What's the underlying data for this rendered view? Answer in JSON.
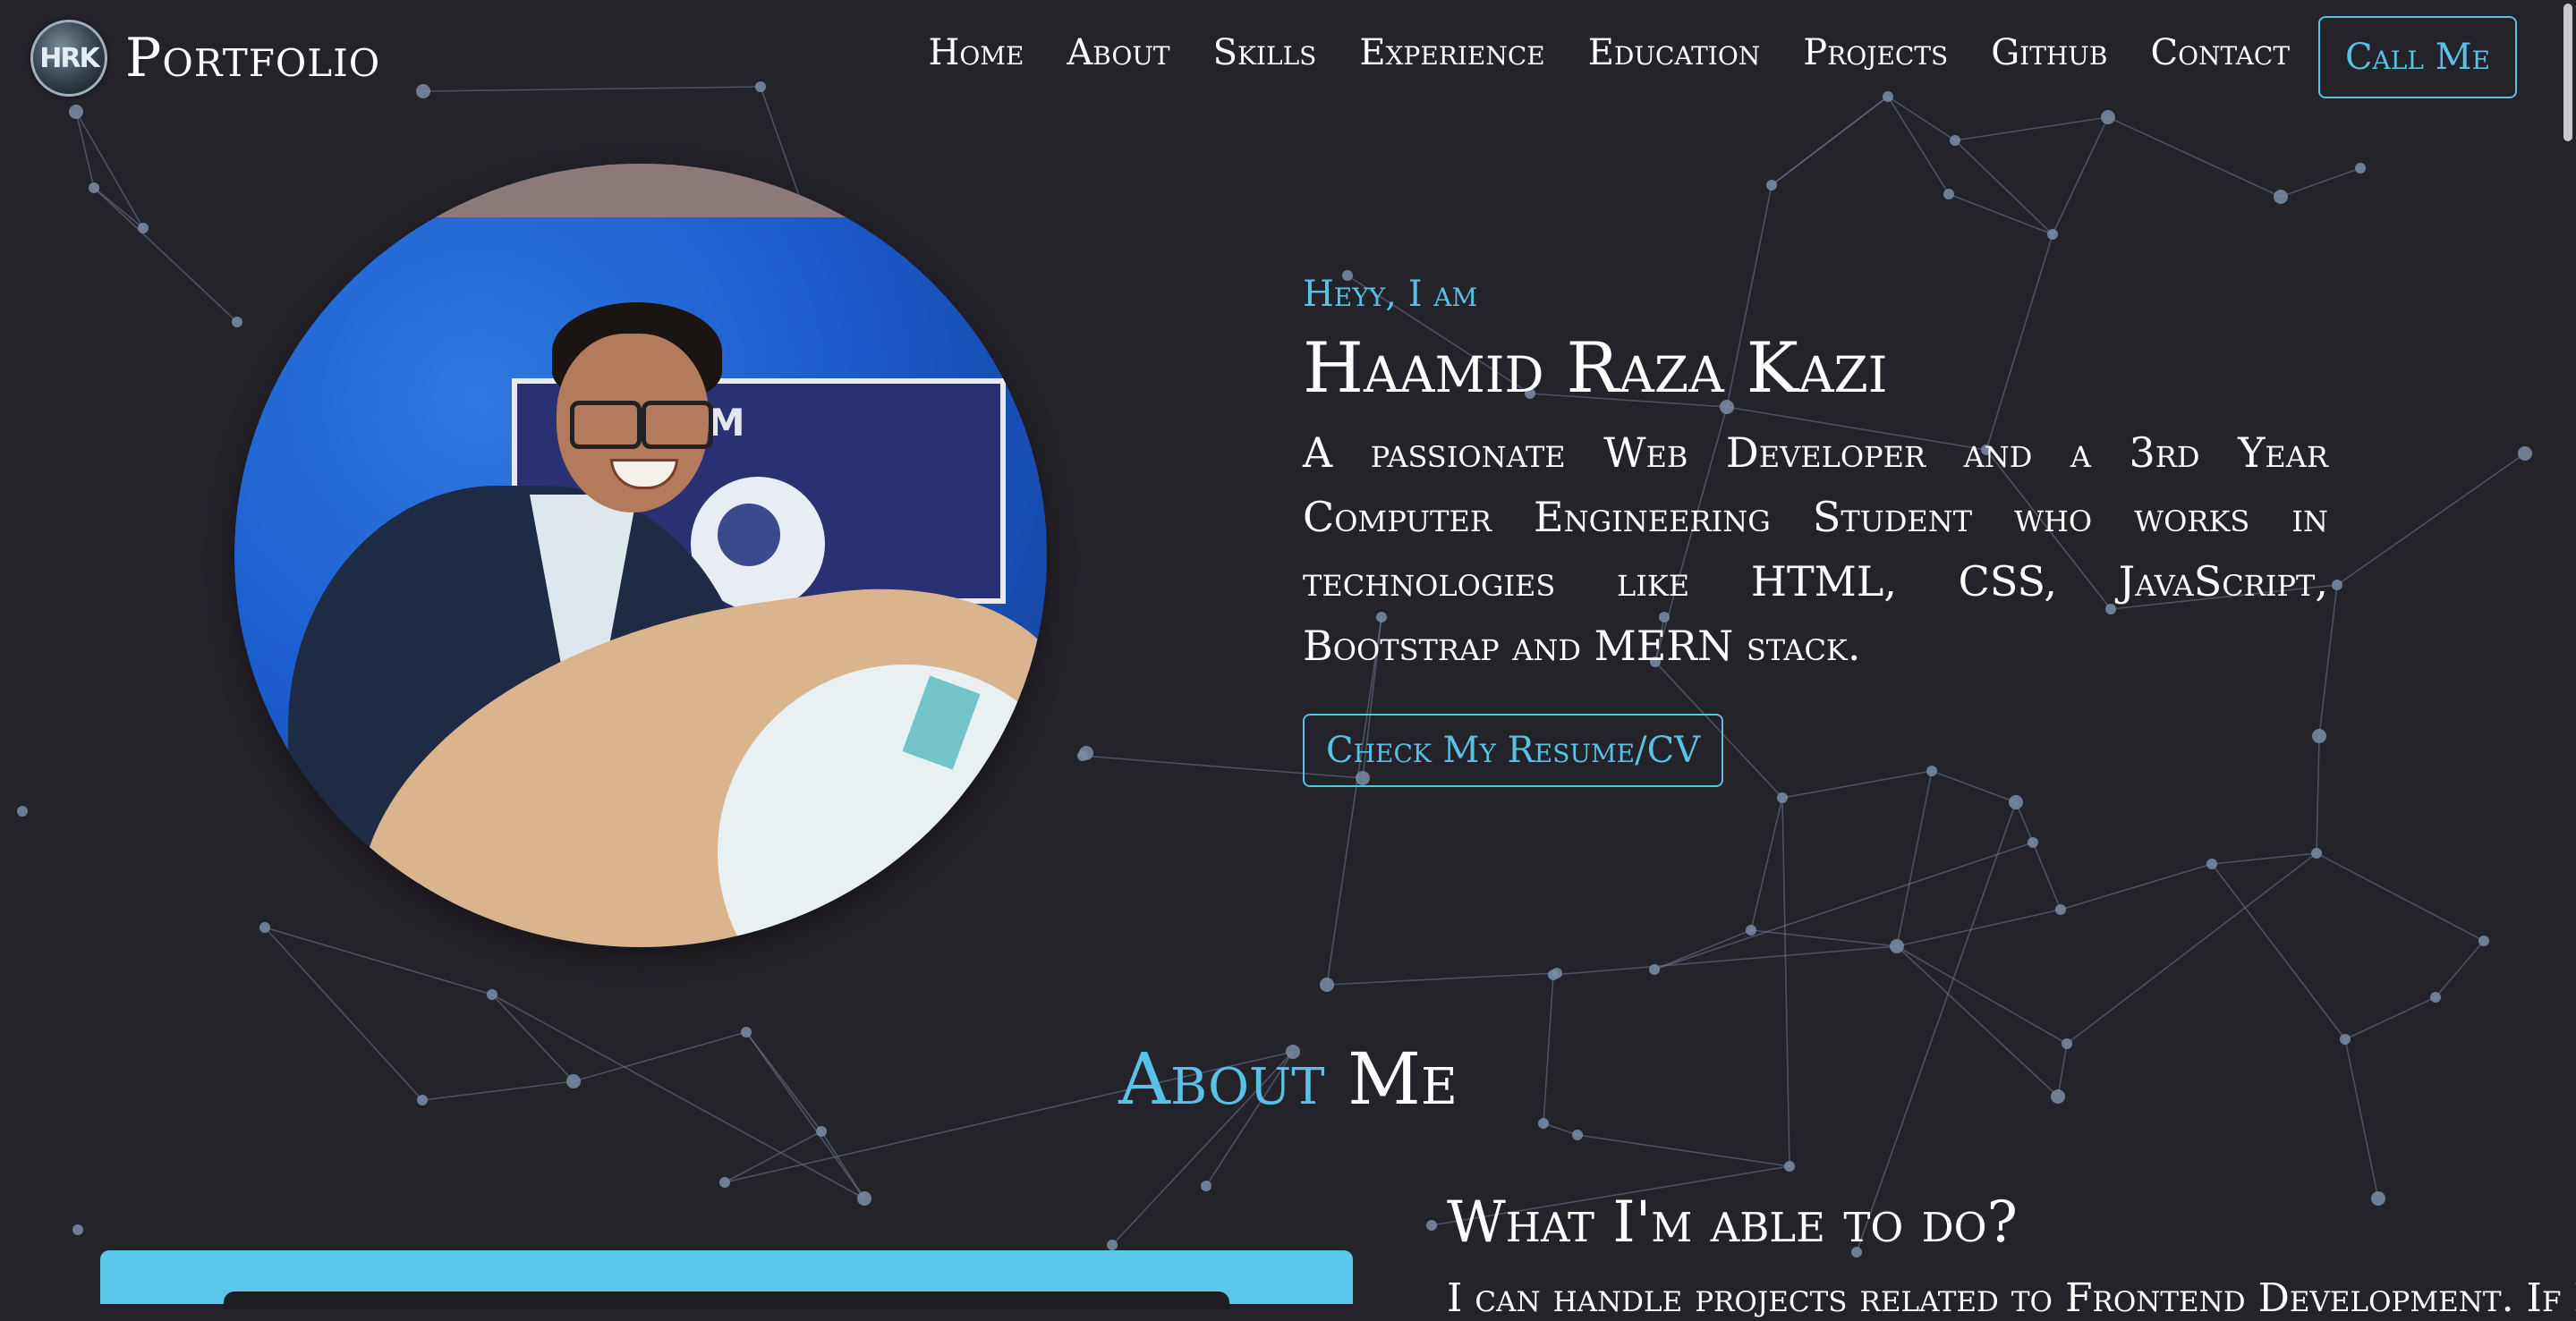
{
  "brand": {
    "logo_text": "HRK",
    "name": "Portfolio"
  },
  "nav": {
    "items": [
      "Home",
      "About",
      "Skills",
      "Experience",
      "Education",
      "Projects",
      "Github",
      "Contact"
    ],
    "call_button": "Call Me"
  },
  "hero": {
    "greeting": "Heyy, I am",
    "name": "Haamid Raza Kazi",
    "tagline": "A passionate Web Developer and a 3rd Year Computer Engineering Student who works in technologies like HTML, CSS, JavaScript, Bootstrap and MERN stack.",
    "resume_button": "Check My Resume/CV",
    "photo": {
      "banner_text": "E SJCEM"
    }
  },
  "about": {
    "title_accent": "About",
    "title_rest": "Me",
    "subtitle": "What I'm able to do?",
    "text": "I can handle projects related to Frontend Development. If I"
  },
  "colors": {
    "background": "#25232a",
    "accent": "#58c1e6",
    "text": "#ffffff",
    "network": "#7a8da6"
  },
  "icons": {
    "logo": "hrk-monogram-logo"
  }
}
